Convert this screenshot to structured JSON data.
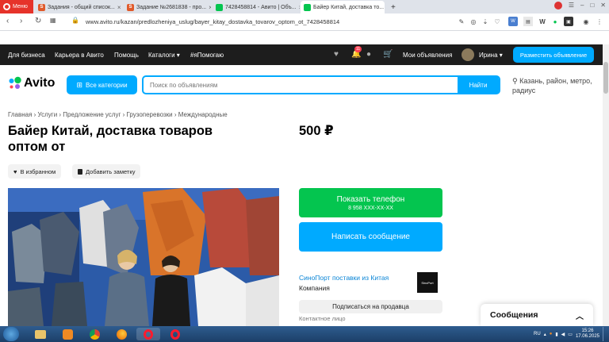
{
  "browser": {
    "menu_label": "Меню",
    "tabs": [
      {
        "label": "Задания - общий список...",
        "icon": "sp-icon"
      },
      {
        "label": "Задание №2681838 - про...",
        "icon": "sp-icon"
      },
      {
        "label": "7428458814 - Авито | Объ...",
        "icon": "avito-icon"
      },
      {
        "label": "Байер Китай, доставка то...",
        "icon": "avito-icon"
      }
    ],
    "new_tab": "+",
    "url": "www.avito.ru/kazan/predlozheniya_uslug/bayer_kitay_dostavka_tovarov_optom_ot_7428458814"
  },
  "topnav": {
    "links": [
      "Для бизнеса",
      "Карьера в Авито",
      "Помощь",
      "Каталоги ▾",
      "#яПомогаю"
    ],
    "notif_count": "11",
    "my_ads": "Мои объявления",
    "user": "Ирина ▾",
    "post_ad": "Разместить объявление"
  },
  "header": {
    "logo": "Avito",
    "categories_btn": "Все категории",
    "search_placeholder": "Поиск по объявлениям",
    "search_btn": "Найти",
    "location": "Казань, район, метро, радиус"
  },
  "listing": {
    "breadcrumb": "Главная › Услуги › Предложение услуг › Грузоперевозки › Международные",
    "title": "Байер Китай, доставка товаров оптом от",
    "price": "500 ₽",
    "favorite_btn": "В избранном",
    "note_btn": "Добавить заметку",
    "phone_btn": "Показать телефон",
    "phone_masked": "8 958 XXX-XX-XX",
    "message_btn": "Написать сообщение",
    "seller_name": "СиноПорт поставки из Китая",
    "seller_type": "Компания",
    "seller_logo_text": "SinoPort",
    "subscribe_btn": "Подписаться на продавца",
    "contact_person": "Контактное лицо"
  },
  "messages_widget": {
    "label": "Сообщения"
  },
  "taskbar": {
    "lang": "RU",
    "time": "15:26",
    "date": "17.06.2025"
  }
}
